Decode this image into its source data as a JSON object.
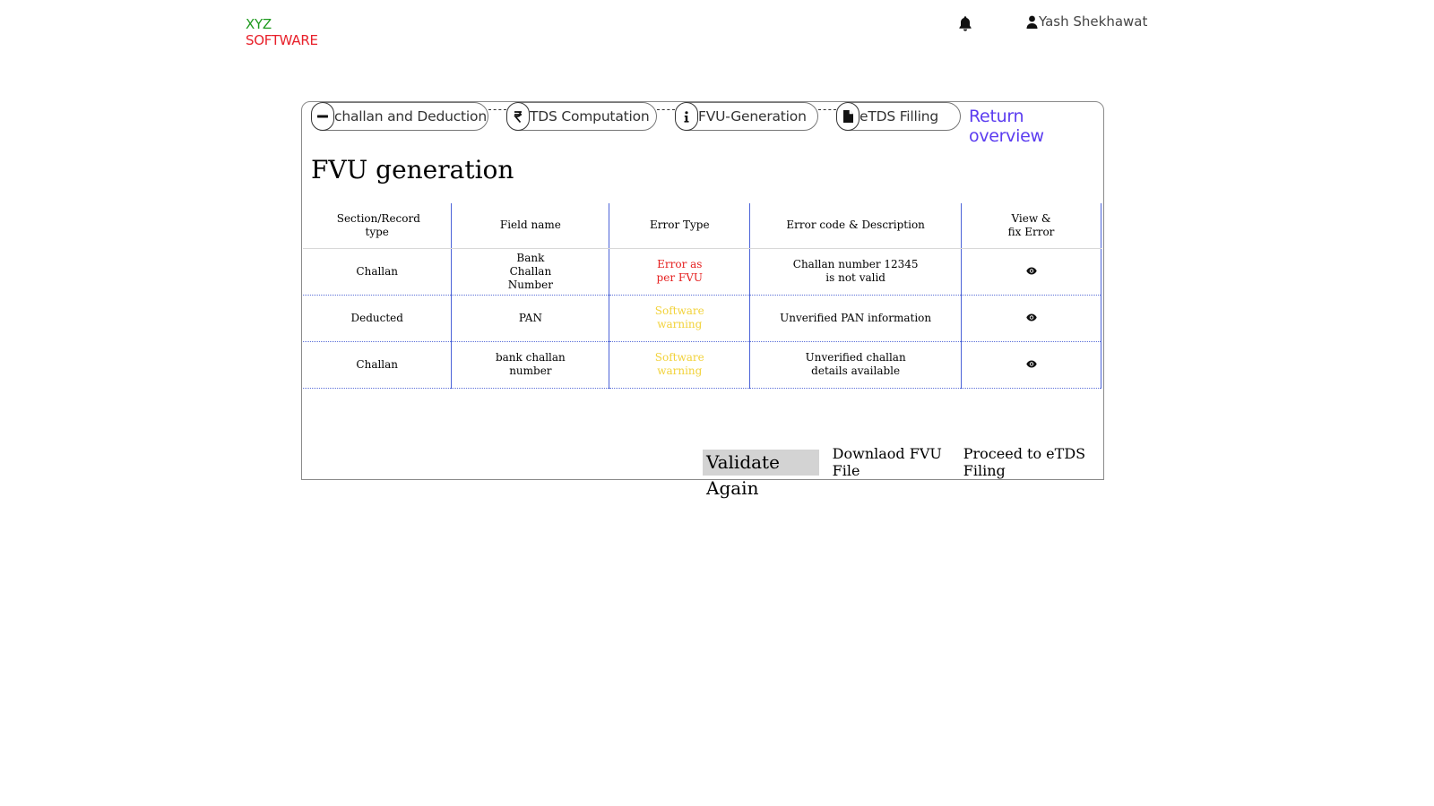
{
  "logo": {
    "line1": "XYZ",
    "line2": "SOFTWARE"
  },
  "header": {
    "notifications_icon": "bell-icon",
    "user_icon": "user-icon",
    "user_name": "Yash Shekhawat"
  },
  "steps": [
    {
      "icon": "minus-circle-icon",
      "label": "challan and Deduction"
    },
    {
      "icon": "rupee-icon",
      "label": "TDS Computation"
    },
    {
      "icon": "info-icon",
      "label": "FVU-Generation"
    },
    {
      "icon": "file-icon",
      "label": "eTDS Filling"
    }
  ],
  "return_overview": "Return overview",
  "page_title": "FVU generation",
  "table": {
    "headers": [
      "Section/Record type",
      "Field name",
      "Error Type",
      "Error code & Description",
      "View & fix Error"
    ],
    "rows": [
      {
        "section": "Challan",
        "field": "Bank Challan Number",
        "error_type": "Error as per FVU",
        "description": "Challan number 12345 is not valid",
        "action_icon": "eye-icon"
      },
      {
        "section": "Deducted",
        "field": "PAN",
        "error_type": "Software warning",
        "description": "Unverified PAN information",
        "action_icon": "eye-icon"
      },
      {
        "section": "Challan",
        "field": "bank challan number",
        "error_type": "Software warning",
        "description": "Unverified challan details available",
        "action_icon": "eye-icon"
      }
    ]
  },
  "actions": {
    "validate": "Validate Again",
    "download": "Downlaod FVU File",
    "proceed": "Proceed to eTDS Filing"
  },
  "colors": {
    "logo_green": "#1e9a1e",
    "logo_red": "#e8202a",
    "link": "#5b3cf0",
    "error": "#e52020",
    "warning": "#f2d23a",
    "grid": "#4b63d8"
  }
}
